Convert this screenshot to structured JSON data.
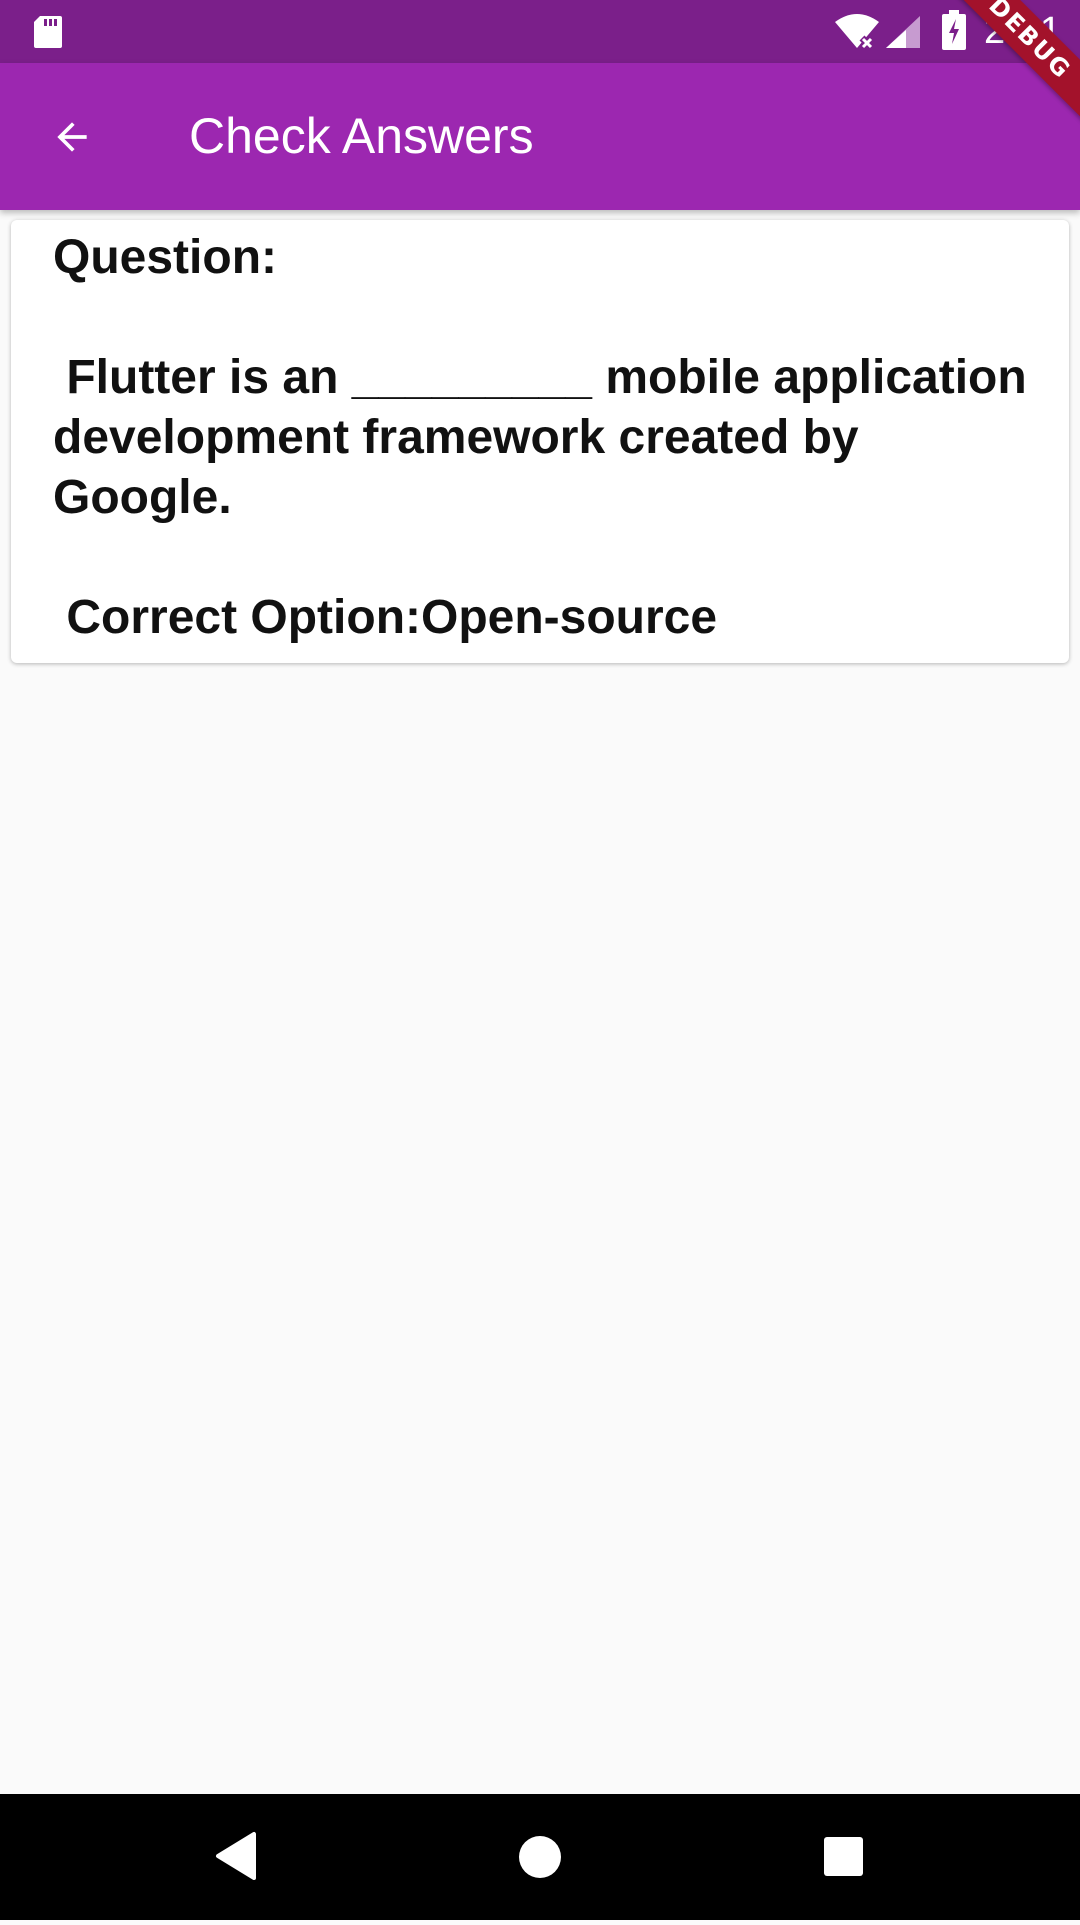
{
  "status_bar": {
    "time": "2:51",
    "icons": [
      "sd-card-icon",
      "wifi-icon",
      "signal-icon",
      "battery-charging-icon"
    ]
  },
  "debug_banner": "DEBUG",
  "app_bar": {
    "title": "Check Answers",
    "back_icon": "arrow-back-icon"
  },
  "card": {
    "text": "Question:\n\n Flutter is an _________ mobile application development framework created by Google.\n\n Correct Option:Open-source"
  },
  "nav_bar": {
    "buttons": [
      "back-triangle-icon",
      "home-circle-icon",
      "recents-square-icon"
    ]
  },
  "colors": {
    "status_bar": "#7b1f8a",
    "app_bar": "#9c27b0",
    "background": "#fafafa",
    "card": "#ffffff",
    "debug_ribbon": "#a3122b"
  }
}
